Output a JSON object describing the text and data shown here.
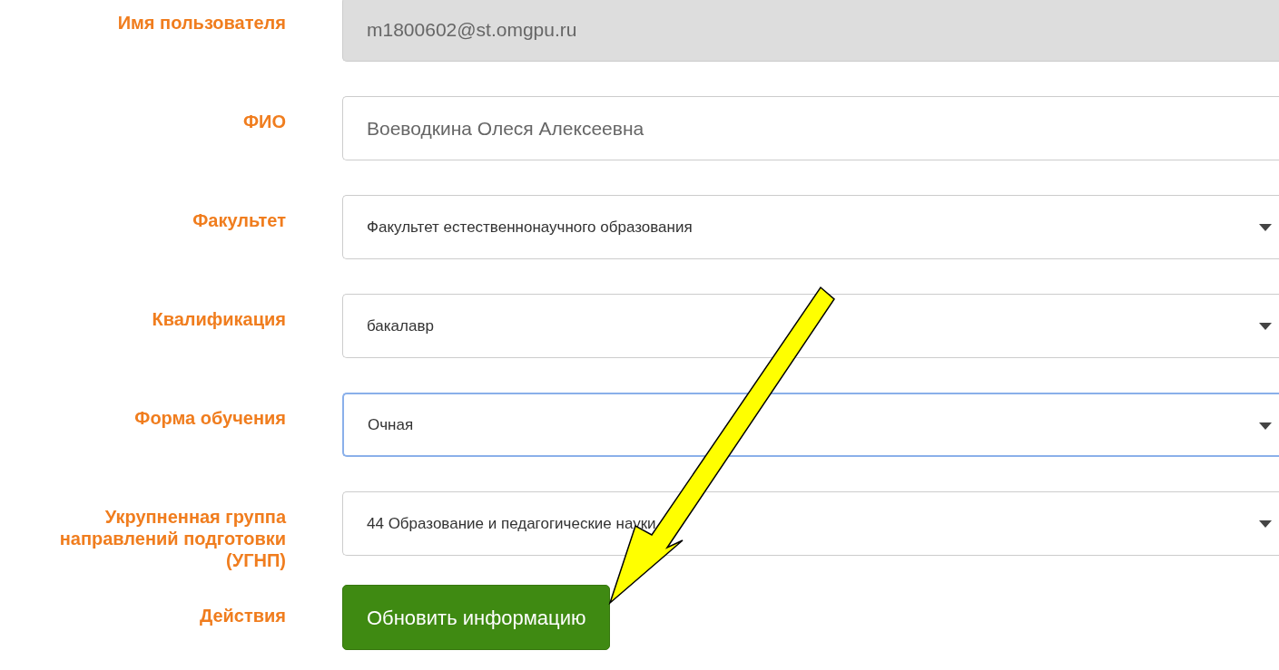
{
  "fields": [
    {
      "label": "Имя пользователя",
      "kind": "text",
      "value": "m1800602@st.omgpu.ru",
      "disabled": true,
      "focused": false
    },
    {
      "label": "ФИО",
      "kind": "text",
      "value": "Воеводкина Олеся Алексеевна",
      "disabled": false,
      "focused": false
    },
    {
      "label": "Факультет",
      "kind": "select",
      "value": "Факультет естественнонаучного образования",
      "disabled": false,
      "focused": false
    },
    {
      "label": "Квалификация",
      "kind": "select",
      "value": "бакалавр",
      "disabled": false,
      "focused": false
    },
    {
      "label": "Форма обучения",
      "kind": "select",
      "value": "Очная",
      "disabled": false,
      "focused": true
    },
    {
      "label": "Укрупненная группа направлений подготовки (УГНП)",
      "kind": "select",
      "value": "44 Образование и педагогические науки",
      "disabled": false,
      "focused": false
    }
  ],
  "actions": {
    "label": "Действия",
    "button": "Обновить информацию"
  }
}
